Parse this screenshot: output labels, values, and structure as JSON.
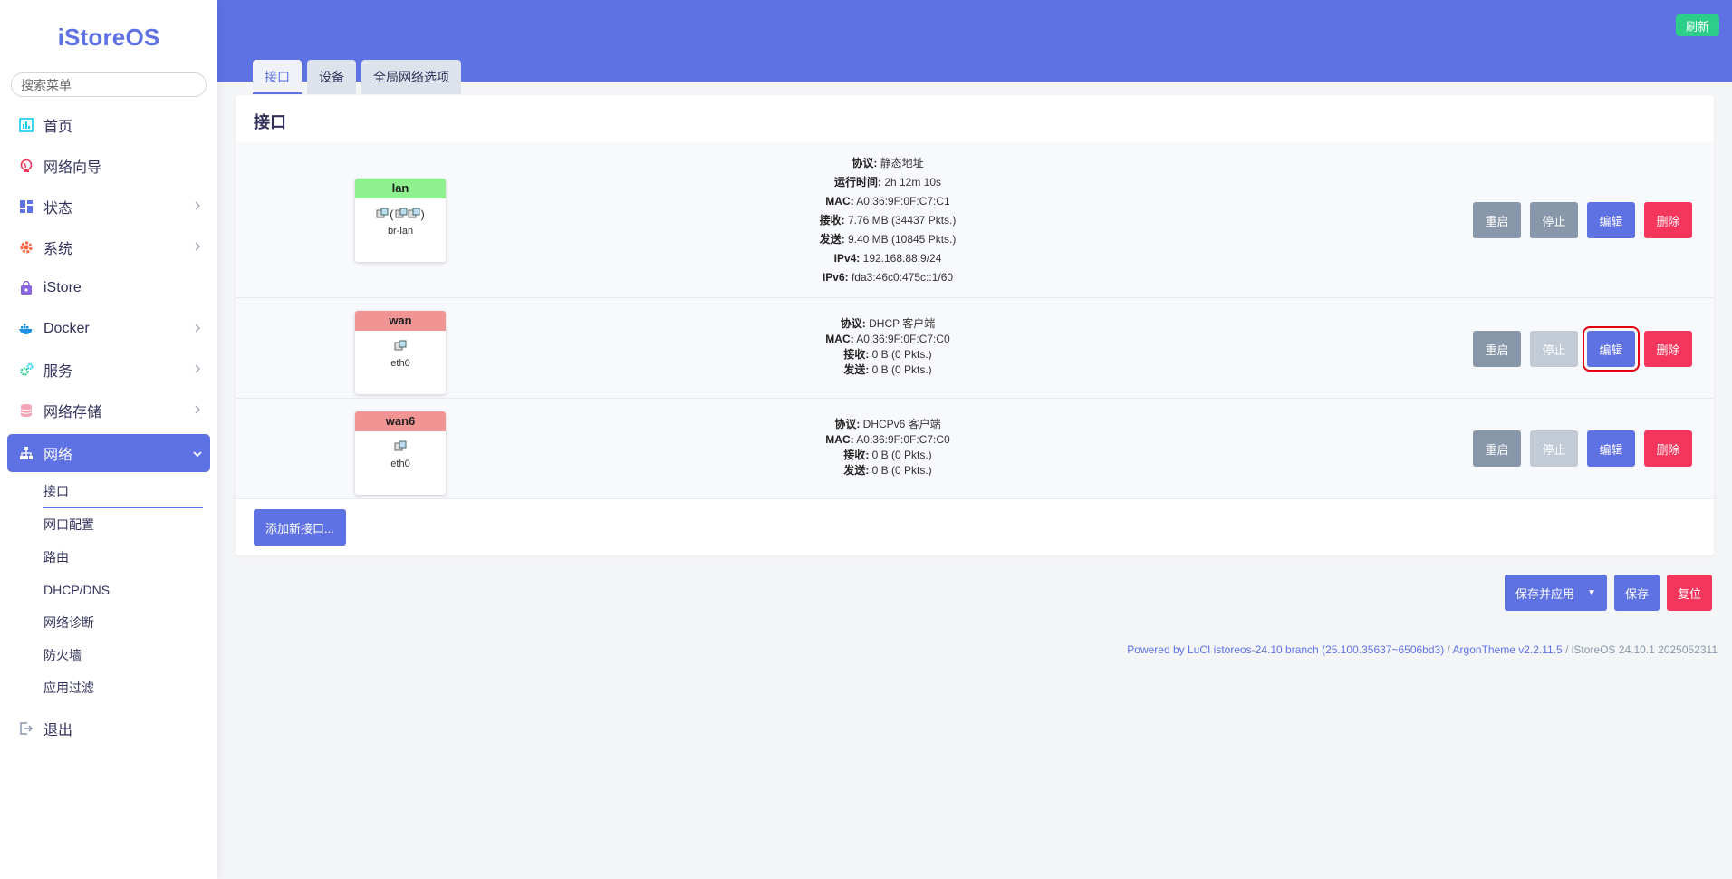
{
  "sidebar": {
    "logo": "iStoreOS",
    "search_placeholder": "搜索菜单",
    "items": [
      {
        "label": "首页"
      },
      {
        "label": "网络向导"
      },
      {
        "label": "状态"
      },
      {
        "label": "系统"
      },
      {
        "label": "iStore"
      },
      {
        "label": "Docker"
      },
      {
        "label": "服务"
      },
      {
        "label": "网络存储"
      },
      {
        "label": "网络"
      }
    ],
    "subitems": [
      "接口",
      "网口配置",
      "路由",
      "DHCP/DNS",
      "网络诊断",
      "防火墙",
      "应用过滤"
    ],
    "logout": "退出"
  },
  "header": {
    "refresh_label": "刷新"
  },
  "tabs": [
    {
      "label": "接口"
    },
    {
      "label": "设备"
    },
    {
      "label": "全局网络选项"
    }
  ],
  "panel": {
    "title": "接口",
    "add_label": "添加新接口...",
    "buttons": {
      "restart": "重启",
      "stop": "停止",
      "edit": "编辑",
      "delete": "删除"
    },
    "interfaces": [
      {
        "name": "lan",
        "icons": "(",
        "icons_close": ")",
        "device": "br-lan",
        "info": [
          {
            "k": "协议:",
            "v": "静态地址"
          },
          {
            "k": "运行时间:",
            "v": "2h 12m 10s"
          },
          {
            "k": "MAC:",
            "v": "A0:36:9F:0F:C7:C1"
          },
          {
            "k": "接收:",
            "v": "7.76 MB (34437 Pkts.)"
          },
          {
            "k": "发送:",
            "v": "9.40 MB (10845 Pkts.)"
          },
          {
            "k": "IPv4:",
            "v": "192.168.88.9/24"
          },
          {
            "k": "IPv6:",
            "v": "fda3:46c0:475c::1/60"
          }
        ]
      },
      {
        "name": "wan",
        "device": "eth0",
        "info": [
          {
            "k": "协议:",
            "v": "DHCP 客户端"
          },
          {
            "k": "MAC:",
            "v": "A0:36:9F:0F:C7:C0"
          },
          {
            "k": "接收:",
            "v": "0 B (0 Pkts.)"
          },
          {
            "k": "发送:",
            "v": "0 B (0 Pkts.)"
          }
        ]
      },
      {
        "name": "wan6",
        "device": "eth0",
        "info": [
          {
            "k": "协议:",
            "v": "DHCPv6 客户端"
          },
          {
            "k": "MAC:",
            "v": "A0:36:9F:0F:C7:C0"
          },
          {
            "k": "接收:",
            "v": "0 B (0 Pkts.)"
          },
          {
            "k": "发送:",
            "v": "0 B (0 Pkts.)"
          }
        ]
      }
    ]
  },
  "actions": {
    "save_apply": "保存并应用",
    "save": "保存",
    "reset": "复位"
  },
  "footer": {
    "luci": "Powered by LuCI istoreos-24.10 branch (25.100.35637~6506bd3)",
    "sep1": " / ",
    "theme": "ArgonTheme v2.2.11.5",
    "sep2": " / ",
    "version": "iStoreOS 24.10.1 2025052311"
  },
  "colors": {
    "accent": "#5e72e4",
    "lan_badge": "#8ef08e",
    "wan_badge": "#f09494",
    "success": "#2dce89",
    "danger": "#f5365c"
  }
}
